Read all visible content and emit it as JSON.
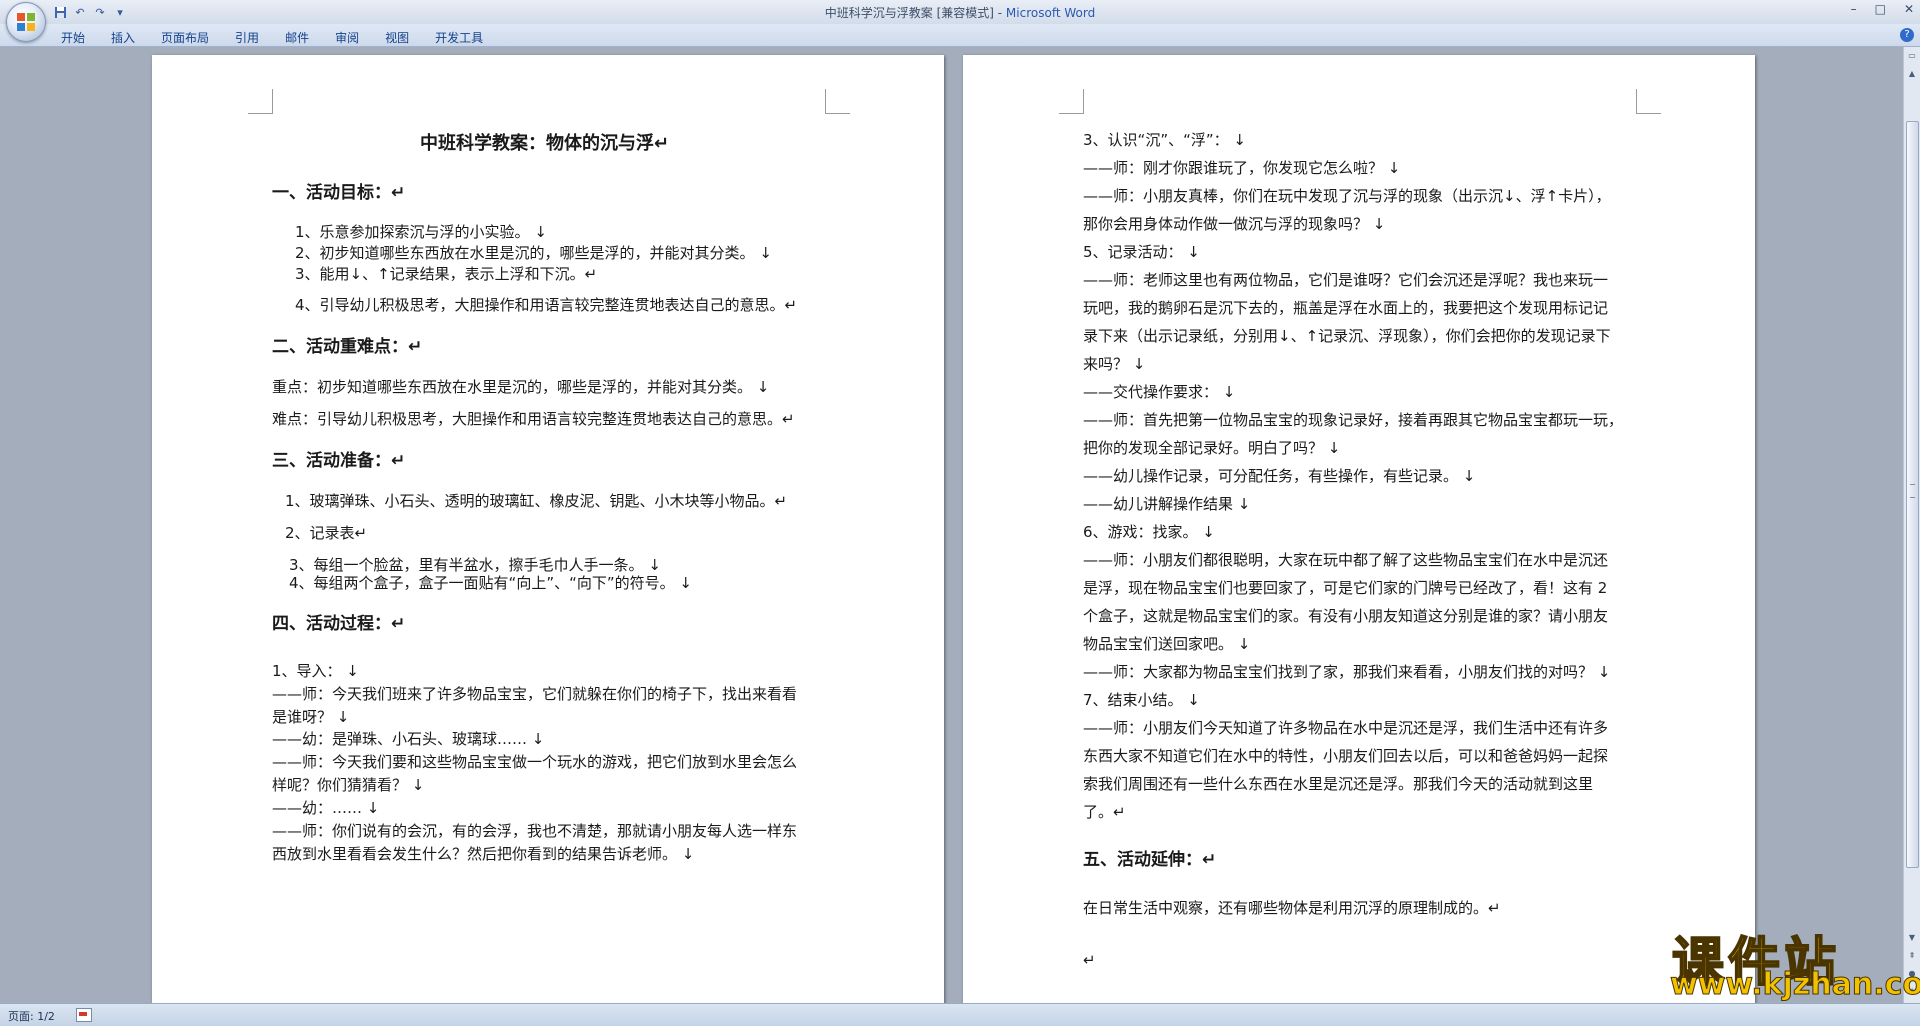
{
  "window": {
    "title": "中班科学沉与浮教案 [兼容模式] - ",
    "app_name": "Microsoft Word",
    "controls": [
      "–",
      "□",
      "✕"
    ]
  },
  "quick_access": [
    "save-icon",
    "undo-icon",
    "redo-icon",
    "customize-icon"
  ],
  "ribbon": {
    "tabs": [
      "开始",
      "插入",
      "页面布局",
      "引用",
      "邮件",
      "审阅",
      "视图",
      "开发工具"
    ]
  },
  "page1": {
    "lines": [
      "中班科学教案：物体的沉与浮↵",
      "一、活动目标：↵",
      "1、乐意参加探索沉与浮的小实验。 ↓",
      "2、初步知道哪些东西放在水里是沉的，哪些是浮的，并能对其分类。 ↓",
      "3、能用↓、↑记录结果，表示上浮和下沉。↵",
      "4、引导幼儿积极思考，大胆操作和用语言较完整连贯地表达自己的意思。↵",
      "二、活动重难点：↵",
      "重点：初步知道哪些东西放在水里是沉的，哪些是浮的，并能对其分类。 ↓",
      "难点：引导幼儿积极思考，大胆操作和用语言较完整连贯地表达自己的意思。↵",
      "三、活动准备：↵",
      "1、玻璃弹珠、小石头、透明的玻璃缸、橡皮泥、钥匙、小木块等小物品。↵",
      "2、记录表↵",
      "3、每组一个脸盆，里有半盆水，擦手毛巾人手一条。 ↓",
      "4、每组两个盒子，盒子一面贴有“向上”、“向下”的符号。 ↓",
      "四、活动过程：↵",
      "1、导入： ↓",
      "——师：今天我们班来了许多物品宝宝，它们就躲在你们的椅子下，找出来看看",
      "是谁呀？ ↓",
      "——幼：是弹珠、小石头、玻璃球…… ↓",
      "——师：今天我们要和这些物品宝宝做一个玩水的游戏，把它们放到水里会怎么",
      "样呢？你们猜猜看？ ↓",
      "——幼：…… ↓",
      "——师：你们说有的会沉，有的会浮，我也不清楚，那就请小朋友每人选一样东",
      "西放到水里看看会发生什么？然后把你看到的结果告诉老师。 ↓"
    ]
  },
  "page2": {
    "lines": [
      "3、认识“沉”、“浮”： ↓",
      "——师：刚才你跟谁玩了，你发现它怎么啦？ ↓",
      "——师：小朋友真棒，你们在玩中发现了沉与浮的现象（出示沉↓、浮↑卡片），",
      "那你会用身体动作做一做沉与浮的现象吗？ ↓",
      "5、记录活动： ↓",
      "——师：老师这里也有两位物品，它们是谁呀？它们会沉还是浮呢？我也来玩一",
      "玩吧，我的鹅卵石是沉下去的，瓶盖是浮在水面上的，我要把这个发现用标记记",
      "录下来（出示记录纸，分别用↓、↑记录沉、浮现象），你们会把你的发现记录下",
      "来吗？ ↓",
      "——交代操作要求： ↓",
      "——师：首先把第一位物品宝宝的现象记录好，接着再跟其它物品宝宝都玩一玩，",
      "把你的发现全部记录好。明白了吗？ ↓",
      "——幼儿操作记录，可分配任务，有些操作，有些记录。 ↓",
      "——幼儿讲解操作结果 ↓",
      "6、游戏：找家。 ↓",
      "——师：小朋友们都很聪明，大家在玩中都了解了这些物品宝宝们在水中是沉还",
      "是浮，现在物品宝宝们也要回家了，可是它们家的门牌号已经改了，看！这有 2",
      "个盒子，这就是物品宝宝们的家。有没有小朋友知道这分别是谁的家？请小朋友",
      "物品宝宝们送回家吧。 ↓",
      "——师：大家都为物品宝宝们找到了家，那我们来看看，小朋友们找的对吗？ ↓",
      "7、结束小结。 ↓",
      "——师：小朋友们今天知道了许多物品在水中是沉还是浮，我们生活中还有许多",
      "东西大家不知道它们在水中的特性，小朋友们回去以后，可以和爸爸妈妈一起探",
      "索我们周围还有一些什么东西在水里是沉还是浮。那我们今天的活动就到这里",
      "了。↵",
      "五、活动延伸：↵",
      "在日常生活中观察，还有哪些物体是利用沉浮的原理制成的。↵",
      "↵"
    ]
  },
  "statusbar": {
    "page": "页面: 1/2"
  },
  "watermark": {
    "line1": "课件站",
    "line2": "www.kjzhan.com"
  }
}
